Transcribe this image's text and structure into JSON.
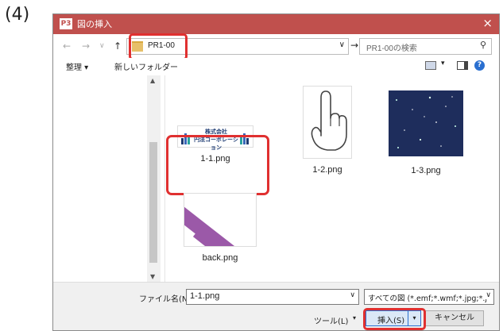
{
  "step_label": "(4)",
  "window": {
    "title": "図の挿入",
    "app_icon": "P3"
  },
  "nav": {
    "back": "←",
    "forward": "→",
    "recent": "∨",
    "up": "↑",
    "go": "→"
  },
  "address": {
    "value": "PR1-00",
    "dropdown": "∨"
  },
  "search": {
    "placeholder": "PR1-00の検索",
    "icon": "⚲"
  },
  "toolbar": {
    "organize": "整理 ▾",
    "new_folder": "新しいフォルダー",
    "view_dropdown": "▾",
    "help": "?"
  },
  "files": [
    {
      "name": "1-1.png",
      "logo_text_1": "株式会社",
      "logo_text_2": "円法コーポレーション"
    },
    {
      "name": "1-2.png"
    },
    {
      "name": "1-3.png"
    },
    {
      "name": "back.png"
    }
  ],
  "bottom": {
    "filename_label": "ファイル名(N):",
    "filename_value": "1-1.png",
    "filetype_value": "すべての図 (*.emf;*.wmf;*.jpg;*.j",
    "tools_label": "ツール(L)",
    "tools_dd": "▾",
    "insert_label": "挿入(S)",
    "insert_dd": "▾",
    "cancel_label": "キャンセル"
  },
  "colors": {
    "titlebar": "#c0504d",
    "highlight": "#e03030",
    "accent_blue": "#2a6fd0"
  }
}
